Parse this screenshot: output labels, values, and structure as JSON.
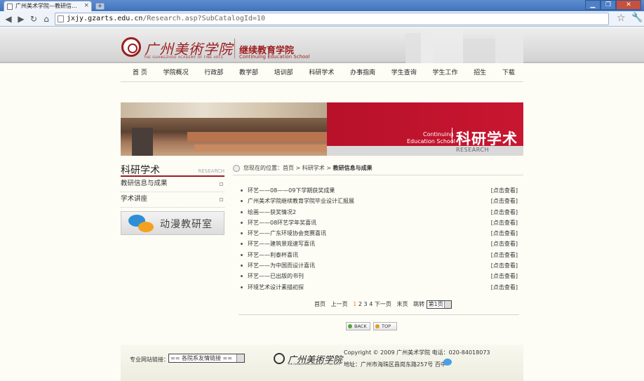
{
  "browser": {
    "tab_title": "广州美术学院—教研信...",
    "tab_close": "×",
    "new_tab": "+",
    "window_buttons": [
      "▁",
      "❐",
      "✕"
    ],
    "nav_back": "◀",
    "nav_forward": "▶",
    "nav_reload": "↻",
    "nav_home": "⌂",
    "url_host": "jxjy.gzarts.edu.cn",
    "url_path": "/Research.asp?SubCatalogId=10",
    "star": "☆",
    "wrench": "🔧"
  },
  "header": {
    "logo_cn": "广州美術学院",
    "logo_en": "THE GUANGZHOU ACADEMY OF FINE ARTS",
    "school_cn": "继续教育学院",
    "school_en": "Continuing Education School"
  },
  "menu": [
    "首 页",
    "学院概况",
    "行政部",
    "教学部",
    "培训部",
    "科研学术",
    "办事指南",
    "学生查询",
    "学生工作",
    "招生",
    "下载"
  ],
  "banner": {
    "en_line1": "Continuing",
    "en_line2": "Education School",
    "cn": "科研学术",
    "sub": "RESEARCH"
  },
  "sidebar": {
    "title_cn": "科研学术",
    "title_en": "RESEARCH",
    "items": [
      "教研信息与成果",
      "学术讲座"
    ],
    "anime_label": "动漫教研室"
  },
  "breadcrumb": {
    "prefix": "您现在的位置：首页 > 科研学术 > ",
    "current": "教研信息与成果"
  },
  "articles": [
    {
      "title": "环艺——08——09下学期获奖成果",
      "link": "[点击查看]"
    },
    {
      "title": "广州美术学院继续教育学院毕业设计汇报展",
      "link": "[点击查看]"
    },
    {
      "title": "绘画——获奖情况2",
      "link": "[点击查看]"
    },
    {
      "title": "环艺——08环艺学年奖喜讯",
      "link": "[点击查看]"
    },
    {
      "title": "环艺——广东环境协会竞赛喜讯",
      "link": "[点击查看]"
    },
    {
      "title": "环艺——建筑景观速写喜讯",
      "link": "[点击查看]"
    },
    {
      "title": "环艺——利泰杯喜讯",
      "link": "[点击查看]"
    },
    {
      "title": "环艺——为中国而设计喜讯",
      "link": "[点击查看]"
    },
    {
      "title": "环艺——已出版的书刊",
      "link": "[点击查看]"
    },
    {
      "title": "环境艺术设计素描初探",
      "link": "[点击查看]"
    }
  ],
  "pager": {
    "first": "首页",
    "prev": "上一页",
    "current": "1",
    "pages": "2 3 4",
    "next": "下一页",
    "last": "末页",
    "jump": "跳转",
    "select": "第1页"
  },
  "buttons": {
    "back": "BACK",
    "top": "TOP"
  },
  "footer": {
    "link_label": "专业网站链接：",
    "link_select": "== 各院系友情链接 ==",
    "logo_cn": "广州美術学院",
    "logo_en": "THE GUANGZHOU ACADEMY OF FINE ARTS",
    "copyright": "Copyright © 2009 广州美术学院 电话：020-84018073",
    "address": "地址：广州市海珠区昌岗东路257号",
    "stat": "百中"
  },
  "colors": {
    "brand_red": "#9c1c1e",
    "banner_red": "#c81630",
    "pager_current": "#e7852b"
  }
}
